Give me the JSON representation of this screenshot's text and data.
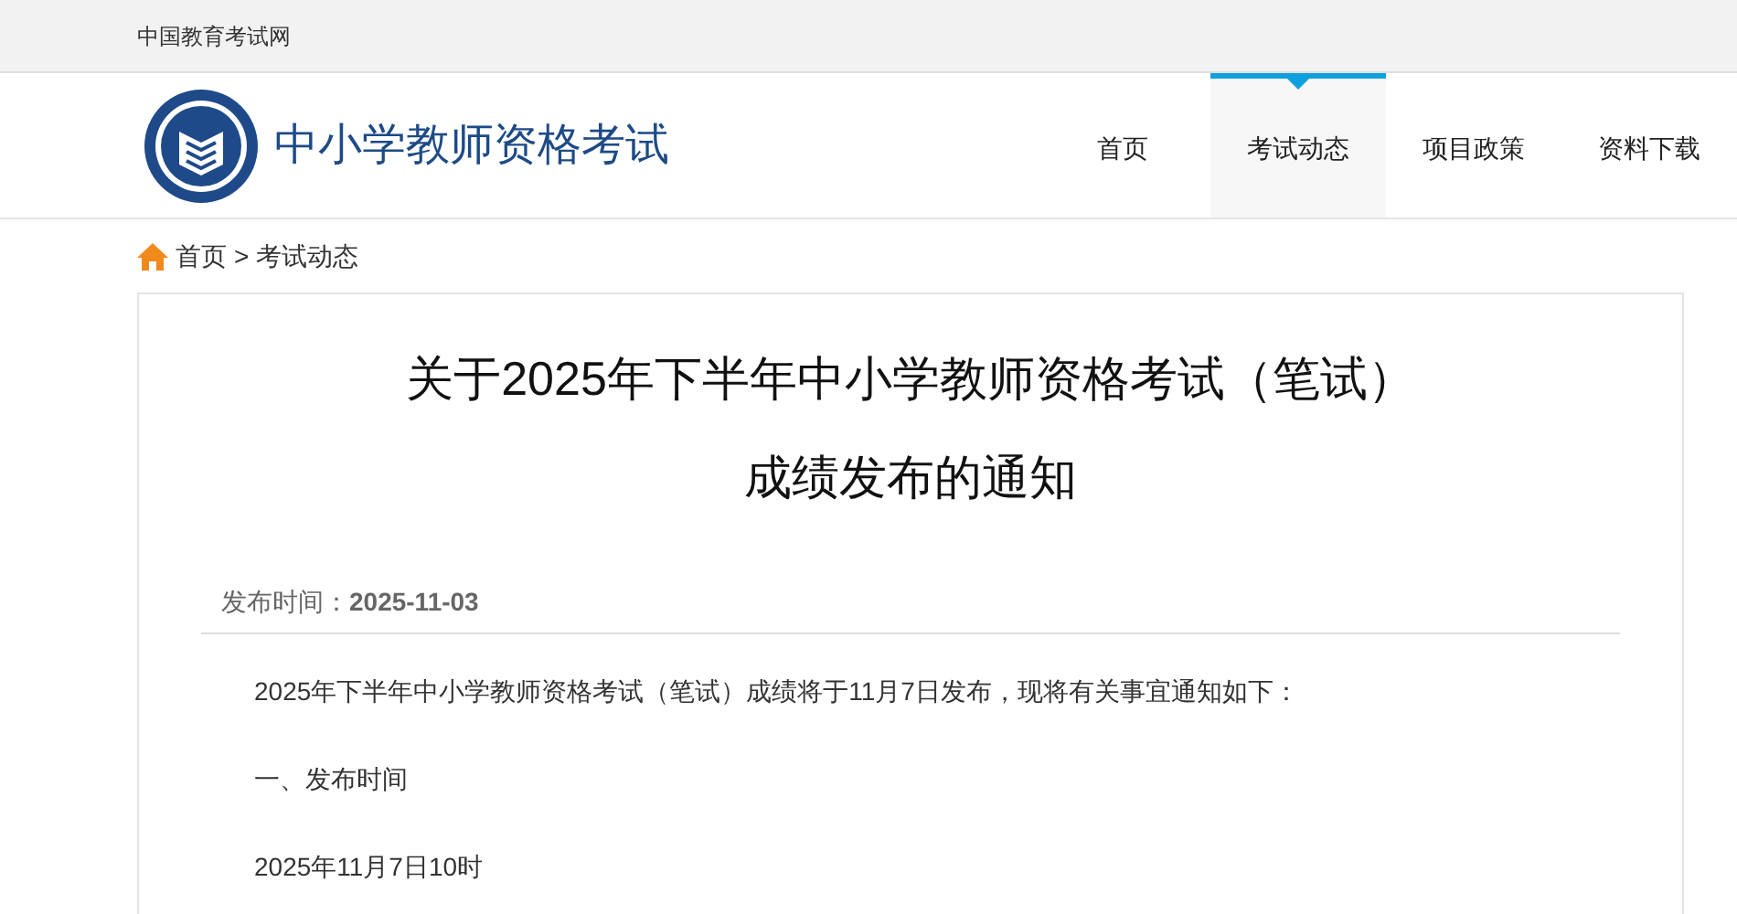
{
  "top_bar": {
    "site_link": "中国教育考试网"
  },
  "header": {
    "site_name": "中小学教师资格考试",
    "nav": [
      {
        "label": "首页",
        "selected": false
      },
      {
        "label": "考试动态",
        "selected": true
      },
      {
        "label": "项目政策",
        "selected": false
      },
      {
        "label": "资料下载",
        "selected": false
      }
    ]
  },
  "breadcrumb": [
    {
      "label": "首页"
    },
    {
      "label": ">"
    },
    {
      "label": "考试动态"
    }
  ],
  "article": {
    "title_lines": [
      "关于2025年下半年中小学教师资格考试（笔试）",
      "成绩发布的通知"
    ],
    "date_label": "发布时间：",
    "date": "2025-11-03",
    "paragraphs": [
      "2025年下半年中小学教师资格考试（笔试）成绩将于11月7日发布，现将有关事宜通知如下：",
      "一、发布时间",
      "2025年11月7日10时"
    ]
  }
}
